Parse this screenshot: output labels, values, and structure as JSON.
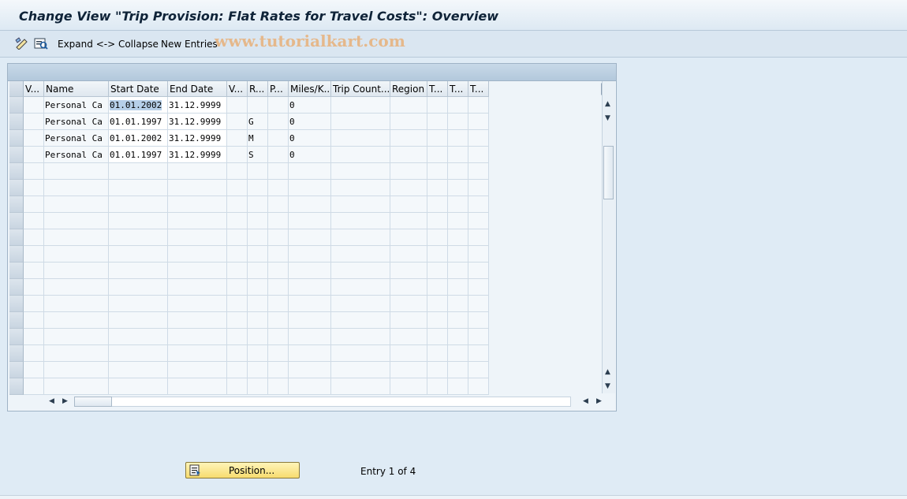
{
  "window": {
    "title": "Change View \"Trip Provision: Flat Rates for Travel Costs\": Overview"
  },
  "toolbar": {
    "icons": [
      "display-change-icon",
      "details-icon"
    ],
    "expand_collapse_label": "Expand <-> Collapse",
    "new_entries_label": "New Entries"
  },
  "watermark": "www.tutorialkart.com",
  "table": {
    "columns": [
      "V...",
      "Name",
      "Start Date",
      "End Date",
      "V...",
      "R...",
      "P...",
      "Miles/K...",
      "Trip Count...",
      "Region",
      "T...",
      "T...",
      "T..."
    ],
    "rows": [
      [
        "",
        "Personal Ca",
        "01.01.2002",
        "31.12.9999",
        "",
        "",
        "",
        "0",
        "",
        "",
        "",
        "",
        ""
      ],
      [
        "",
        "Personal Ca",
        "01.01.1997",
        "31.12.9999",
        "",
        "G",
        "",
        "0",
        "",
        "",
        "",
        "",
        ""
      ],
      [
        "",
        "Personal Ca",
        "01.01.2002",
        "31.12.9999",
        "",
        "M",
        "",
        "0",
        "",
        "",
        "",
        "",
        ""
      ],
      [
        "",
        "Personal Ca",
        "01.01.1997",
        "31.12.9999",
        "",
        "S",
        "",
        "0",
        "",
        "",
        "",
        "",
        ""
      ]
    ],
    "empty_row_count": 14,
    "selected_cell": {
      "row": 0,
      "column": 2
    }
  },
  "footer": {
    "position_button_label": "Position...",
    "entry_text": "Entry 1 of 4"
  },
  "colors": {
    "background": "#dfebf5",
    "button_yellow": "#f7dc6f",
    "watermark": "#e8b07a"
  }
}
